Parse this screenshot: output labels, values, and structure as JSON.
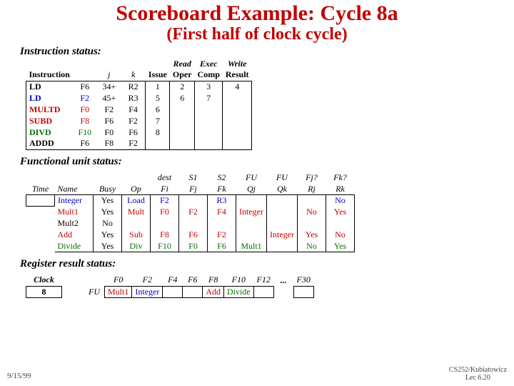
{
  "title": "Scoreboard Example: Cycle 8a",
  "subtitle": "(First half of clock cycle)",
  "sections": {
    "instr": "Instruction status:",
    "fu": "Functional unit status:",
    "reg": "Register result status:"
  },
  "instr_headers": {
    "instruction": "Instruction",
    "j": "j",
    "k": "k",
    "issue": "Issue",
    "read": "Read",
    "oper": "Oper",
    "exec": "Exec",
    "comp": "Comp",
    "write": "Write",
    "result": "Result"
  },
  "instructions": [
    {
      "op": "LD",
      "dest": "F6",
      "j": "34+",
      "k": "R2",
      "issue": "1",
      "read": "2",
      "exec": "3",
      "write": "4"
    },
    {
      "op": "LD",
      "dest": "F2",
      "j": "45+",
      "k": "R3",
      "issue": "5",
      "read": "6",
      "exec": "7",
      "write": ""
    },
    {
      "op": "MULTD",
      "dest": "F0",
      "j": "F2",
      "k": "F4",
      "issue": "6",
      "read": "",
      "exec": "",
      "write": ""
    },
    {
      "op": "SUBD",
      "dest": "F8",
      "j": "F6",
      "k": "F2",
      "issue": "7",
      "read": "",
      "exec": "",
      "write": ""
    },
    {
      "op": "DIVD",
      "dest": "F10",
      "j": "F0",
      "k": "F6",
      "issue": "8",
      "read": "",
      "exec": "",
      "write": ""
    },
    {
      "op": "ADDD",
      "dest": "F6",
      "j": "F8",
      "k": "F2",
      "issue": "",
      "read": "",
      "exec": "",
      "write": ""
    }
  ],
  "fu_headers": {
    "time": "Time",
    "name": "Name",
    "busy": "Busy",
    "op": "Op",
    "dest": "dest",
    "fi": "Fi",
    "s1": "S1",
    "fj": "Fj",
    "s2": "S2",
    "fk": "Fk",
    "fu1": "FU",
    "qj": "Qj",
    "fu2": "FU",
    "qk": "Qk",
    "fjq": "Fj?",
    "rj": "Rj",
    "fkq": "Fk?",
    "rk": "Rk"
  },
  "fu_rows": [
    {
      "name": "Integer",
      "busy": "Yes",
      "op": "Load",
      "fi": "F2",
      "fj": "",
      "fk": "R3",
      "qj": "",
      "qk": "",
      "rj": "",
      "rk": "No"
    },
    {
      "name": "Mult1",
      "busy": "Yes",
      "op": "Mult",
      "fi": "F0",
      "fj": "F2",
      "fk": "F4",
      "qj": "Integer",
      "qk": "",
      "rj": "No",
      "rk": "Yes"
    },
    {
      "name": "Mult2",
      "busy": "No",
      "op": "",
      "fi": "",
      "fj": "",
      "fk": "",
      "qj": "",
      "qk": "",
      "rj": "",
      "rk": ""
    },
    {
      "name": "Add",
      "busy": "Yes",
      "op": "Sub",
      "fi": "F8",
      "fj": "F6",
      "fk": "F2",
      "qj": "",
      "qk": "Integer",
      "rj": "Yes",
      "rk": "No"
    },
    {
      "name": "Divide",
      "busy": "Yes",
      "op": "Div",
      "fi": "F10",
      "fj": "F0",
      "fk": "F6",
      "qj": "Mult1",
      "qk": "",
      "rj": "No",
      "rk": "Yes"
    }
  ],
  "reg_headers": {
    "clock": "Clock",
    "fu": "FU",
    "regs": [
      "F0",
      "F2",
      "F4",
      "F6",
      "F8",
      "F10",
      "F12",
      "...",
      "F30"
    ]
  },
  "clock_value": "8",
  "reg_row": {
    "F0": "Mult1",
    "F2": "Integer",
    "F4": "",
    "F6": "",
    "F8": "Add",
    "F10": "Divide",
    "F12": "",
    "...": "",
    "F30": ""
  },
  "footer": {
    "date": "9/15/99",
    "line1": "CS252/Kubiatowicz",
    "line2": "Lec 6.20"
  }
}
